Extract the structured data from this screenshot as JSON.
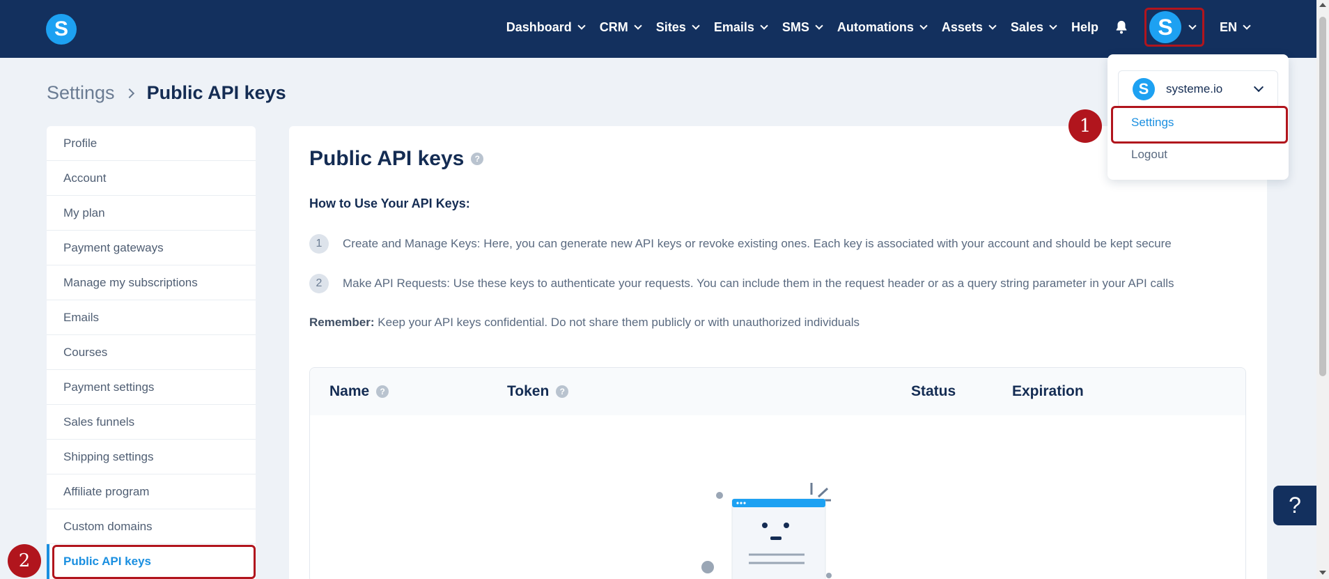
{
  "topbar": {
    "logo_letter": "S",
    "nav": [
      "Dashboard",
      "CRM",
      "Sites",
      "Emails",
      "SMS",
      "Automations",
      "Assets",
      "Sales"
    ],
    "help_label": "Help",
    "avatar_letter": "S",
    "language": "EN"
  },
  "breadcrumb": {
    "parent": "Settings",
    "current": "Public API keys"
  },
  "sidebar": {
    "items": [
      "Profile",
      "Account",
      "My plan",
      "Payment gateways",
      "Manage my subscriptions",
      "Emails",
      "Courses",
      "Payment settings",
      "Sales funnels",
      "Shipping settings",
      "Affiliate program",
      "Custom domains",
      "Public API keys"
    ],
    "active": "Public API keys"
  },
  "main": {
    "title": "Public API keys",
    "howto_heading": "How to Use Your API Keys:",
    "steps": [
      {
        "num": "1",
        "text": "Create and Manage Keys: Here, you can generate new API keys or revoke existing ones. Each key is associated with your account and should be kept secure"
      },
      {
        "num": "2",
        "text": "Make API Requests: Use these keys to authenticate your requests. You can include them in the request header or as a query string parameter in your API calls"
      }
    ],
    "remember_label": "Remember:",
    "remember_text": " Keep your API keys confidential. Do not share them publicly or with unauthorized individuals",
    "table_headers": {
      "name": "Name",
      "token": "Token",
      "status": "Status",
      "expiration": "Expiration"
    }
  },
  "dropdown": {
    "account_letter": "S",
    "account_name": "systeme.io",
    "settings": "Settings",
    "logout": "Logout"
  },
  "markers": {
    "one": "1",
    "two": "2"
  },
  "help_button": "?",
  "colors": {
    "nav_bg": "#13305e",
    "brand_blue": "#1da1f2",
    "link_blue": "#1a8fe0",
    "highlight_red": "#b1151d"
  }
}
